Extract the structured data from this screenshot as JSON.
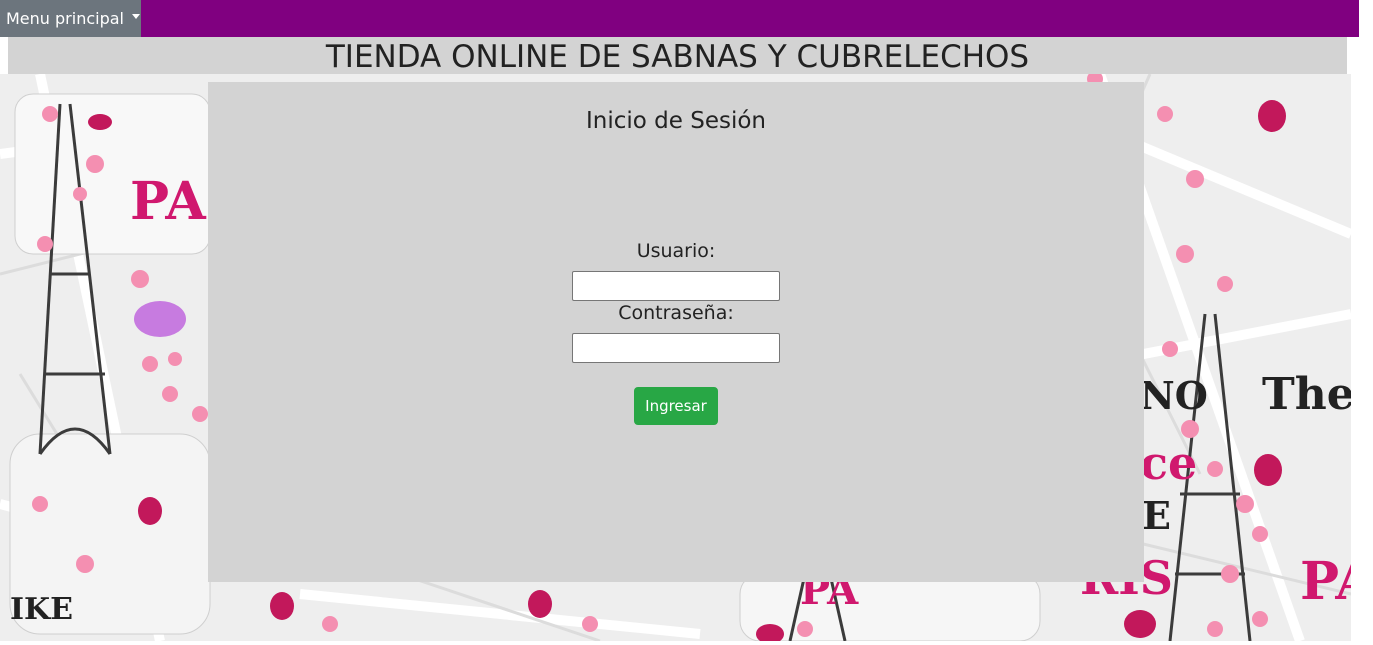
{
  "nav": {
    "menu_label": "Menu principal",
    "bar_color": "#800080",
    "button_color": "#6c757d"
  },
  "header": {
    "title": "TIENDA ONLINE DE SABNAS Y CUBRELECHOS"
  },
  "login": {
    "heading": "Inicio de Sesión",
    "username_label": "Usuario:",
    "username_value": "",
    "password_label": "Contraseña:",
    "password_value": "",
    "submit_label": "Ingresar",
    "submit_color": "#28a745"
  },
  "background": {
    "description_icons": [
      "eiffel-tower-icon",
      "butterfly-icon",
      "flower-icon"
    ],
    "decor_texts": [
      "PAR",
      "PAR",
      "NO",
      "The",
      "ce",
      "E",
      "RIS",
      "IKE"
    ],
    "accent_color": "#d0186e"
  }
}
